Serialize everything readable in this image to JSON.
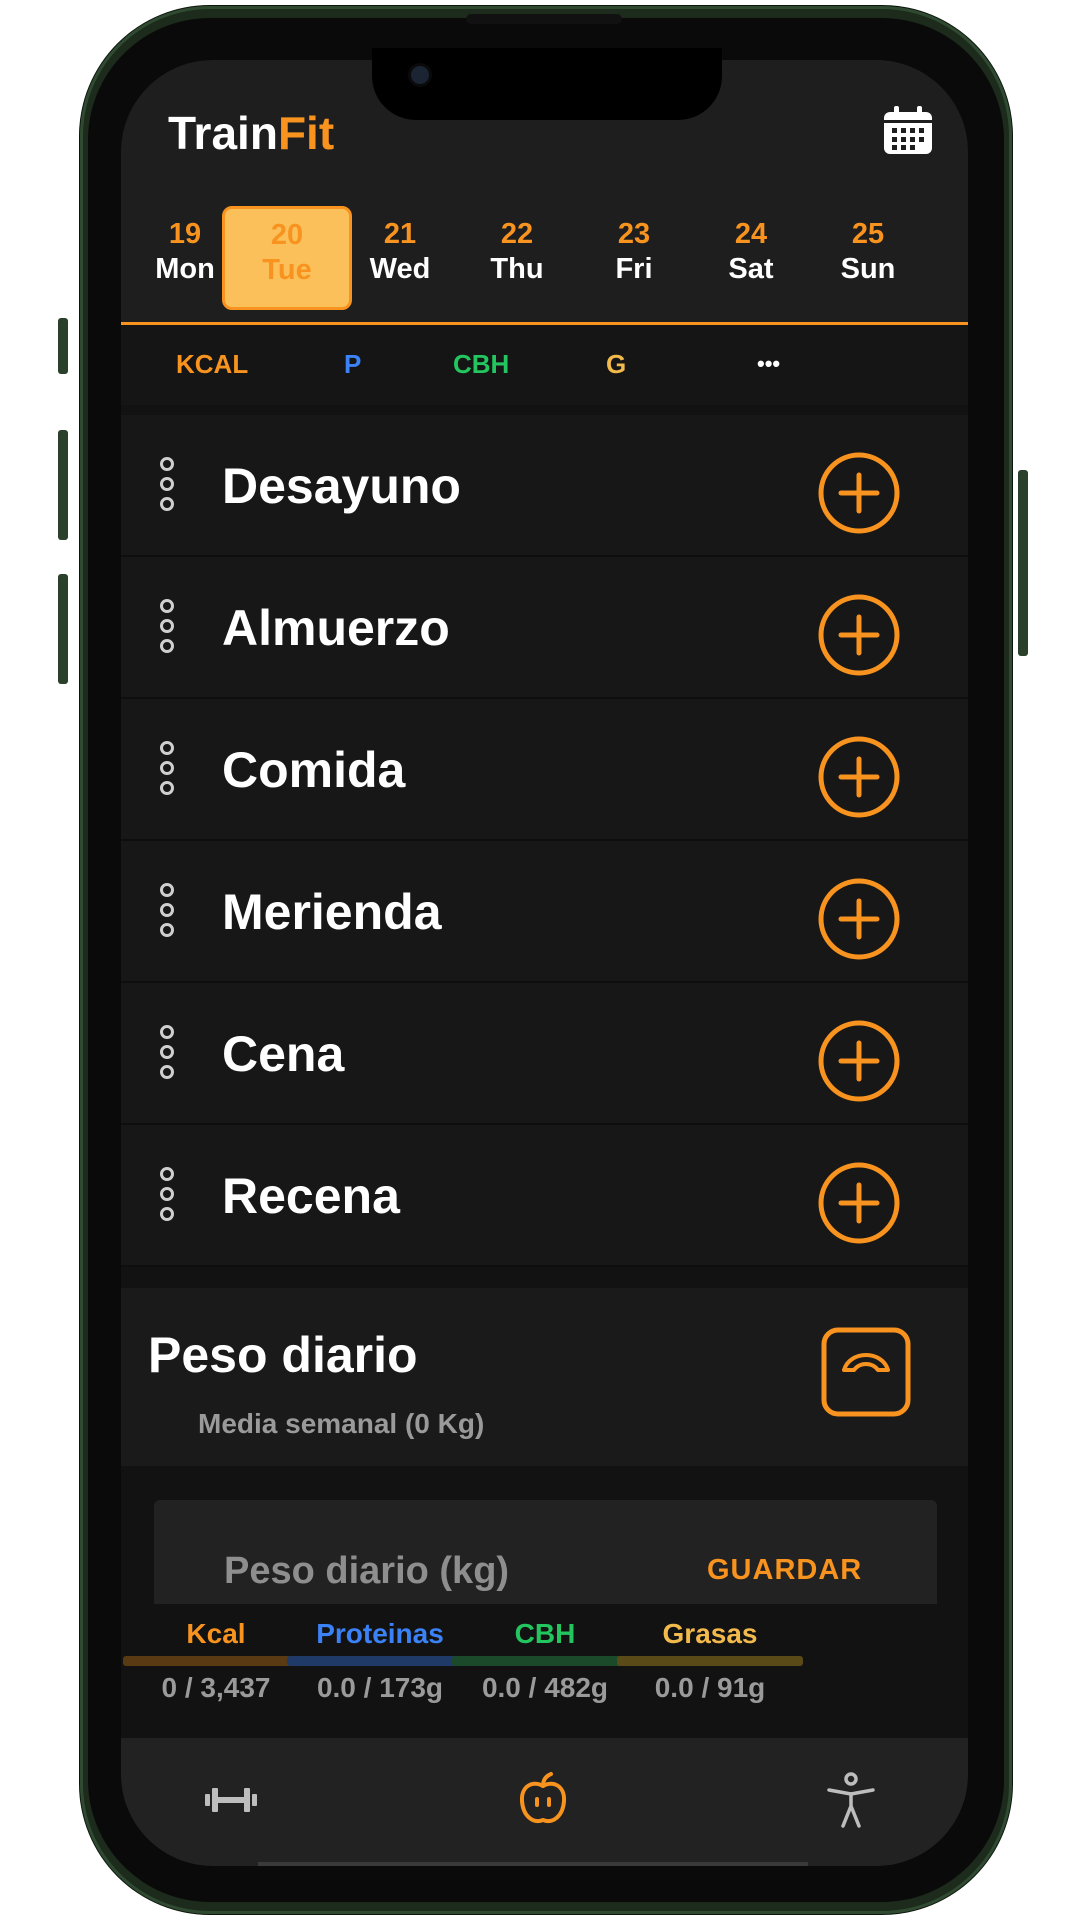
{
  "app": {
    "title_part1": "Train",
    "title_part2": "Fit"
  },
  "icons": {
    "calendar": "calendar-icon",
    "drag": "drag-handle-icon",
    "add": "plus-circle-icon",
    "scale": "weighing-scale-icon",
    "dumbbell": "dumbbell-icon",
    "apple": "apple-icon",
    "person": "person-icon"
  },
  "colors": {
    "accent": "#f7931e",
    "selected_day_bg": "#fbc05a",
    "protein": "#3b82f6",
    "carbs": "#22c55e",
    "fat": "#f2b94c"
  },
  "days": [
    {
      "num": "19",
      "name": "Mon"
    },
    {
      "num": "20",
      "name": "Tue",
      "selected": true
    },
    {
      "num": "21",
      "name": "Wed"
    },
    {
      "num": "22",
      "name": "Thu"
    },
    {
      "num": "23",
      "name": "Fri"
    },
    {
      "num": "24",
      "name": "Sat"
    },
    {
      "num": "25",
      "name": "Sun"
    }
  ],
  "macro_tabs": {
    "kcal": "KCAL",
    "p": "P",
    "cbh": "CBH",
    "g": "G",
    "more": "•••"
  },
  "meals": [
    "Desayuno",
    "Almuerzo",
    "Comida",
    "Merienda",
    "Cena",
    "Recena"
  ],
  "peso": {
    "title": "Peso diario",
    "subtitle": "Media semanal (0 Kg)",
    "input_placeholder": "Peso diario (kg)",
    "save_label": "GUARDAR"
  },
  "summary": [
    {
      "name": "Kcal",
      "value": "0 / 3,437",
      "color": "#f7931e",
      "bar_color": "#5a3a12"
    },
    {
      "name": "Proteinas",
      "value": "0.0 / 173g",
      "color": "#3b82f6",
      "bar_color": "#1f3a66"
    },
    {
      "name": "CBH",
      "value": "0.0 / 482g",
      "color": "#22c55e",
      "bar_color": "#1a4a2a"
    },
    {
      "name": "Grasas",
      "value": "0.0 / 91g",
      "color": "#f2b94c",
      "bar_color": "#5a4a18"
    }
  ]
}
